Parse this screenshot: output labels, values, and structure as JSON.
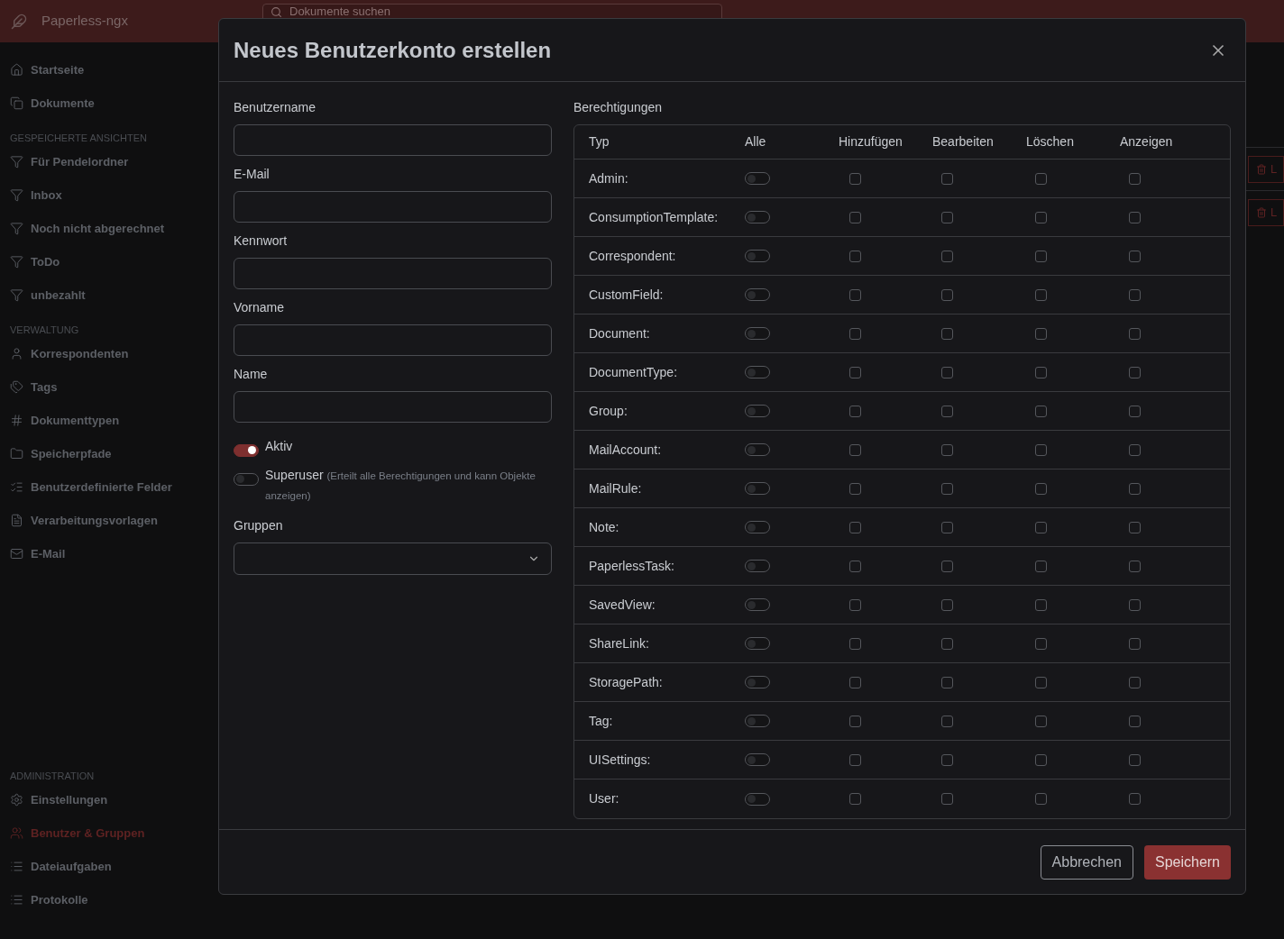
{
  "app": {
    "title": "Paperless-ngx",
    "search": {
      "placeholder": "Dokumente suchen"
    }
  },
  "sidebar": {
    "sections": [
      {
        "items": [
          {
            "label": "Startseite",
            "selected": false
          },
          {
            "label": "Dokumente",
            "selected": false
          }
        ]
      },
      {
        "heading": "GESPEICHERTE ANSICHTEN",
        "items": [
          {
            "label": "Für Pendelordner",
            "selected": false
          },
          {
            "label": "Inbox",
            "selected": false
          },
          {
            "label": "Noch nicht abgerechnet",
            "selected": false
          },
          {
            "label": "ToDo",
            "selected": false
          },
          {
            "label": "unbezahlt",
            "selected": false
          }
        ]
      },
      {
        "heading": "VERWALTUNG",
        "items": [
          {
            "label": "Korrespondenten",
            "selected": false
          },
          {
            "label": "Tags",
            "selected": false
          },
          {
            "label": "Dokumenttypen",
            "selected": false
          },
          {
            "label": "Speicherpfade",
            "selected": false
          },
          {
            "label": "Benutzerdefinierte Felder",
            "selected": false
          },
          {
            "label": "Verarbeitungsvorlagen",
            "selected": false
          },
          {
            "label": "E-Mail",
            "selected": false
          }
        ]
      },
      {
        "heading": "ADMINISTRATION",
        "items": [
          {
            "label": "Einstellungen",
            "selected": false
          },
          {
            "label": "Benutzer & Gruppen",
            "selected": true
          },
          {
            "label": "Dateiaufgaben",
            "selected": false
          },
          {
            "label": "Protokolle",
            "selected": false
          }
        ]
      }
    ]
  },
  "background_rows": [
    {
      "button": "L"
    },
    {
      "button": "L"
    }
  ],
  "dialog": {
    "title": "Neues Benutzerkonto erstellen",
    "fields": [
      {
        "label": "Benutzername"
      },
      {
        "label": "E-Mail"
      },
      {
        "label": "Kennwort"
      },
      {
        "label": "Vorname"
      },
      {
        "label": "Name"
      }
    ],
    "switches": [
      {
        "label": "Aktiv",
        "on": true
      },
      {
        "label": "Superuser",
        "hint": "(Erteilt alle Berechtigungen und kann Objekte anzeigen)",
        "on": false
      }
    ],
    "groups": {
      "label": "Gruppen"
    },
    "permissions": {
      "label": "Berechtigungen",
      "columns": [
        "Typ",
        "Alle",
        "Hinzufügen",
        "Bearbeiten",
        "Löschen",
        "Anzeigen"
      ],
      "rows": [
        {
          "type": "Admin:",
          "all": false,
          "checks": [
            false,
            false,
            false,
            false
          ]
        },
        {
          "type": "ConsumptionTemplate:",
          "all": false,
          "checks": [
            false,
            false,
            false,
            false
          ]
        },
        {
          "type": "Correspondent:",
          "all": false,
          "checks": [
            false,
            false,
            false,
            false
          ]
        },
        {
          "type": "CustomField:",
          "all": false,
          "checks": [
            false,
            false,
            false,
            false
          ]
        },
        {
          "type": "Document:",
          "all": false,
          "checks": [
            false,
            false,
            false,
            false
          ]
        },
        {
          "type": "DocumentType:",
          "all": false,
          "checks": [
            false,
            false,
            false,
            false
          ]
        },
        {
          "type": "Group:",
          "all": false,
          "checks": [
            false,
            false,
            false,
            false
          ]
        },
        {
          "type": "MailAccount:",
          "all": false,
          "checks": [
            false,
            false,
            false,
            false
          ]
        },
        {
          "type": "MailRule:",
          "all": false,
          "checks": [
            false,
            false,
            false,
            false
          ]
        },
        {
          "type": "Note:",
          "all": false,
          "checks": [
            false,
            false,
            false,
            false
          ]
        },
        {
          "type": "PaperlessTask:",
          "all": false,
          "checks": [
            false,
            false,
            false,
            false
          ]
        },
        {
          "type": "SavedView:",
          "all": false,
          "checks": [
            false,
            false,
            false,
            false
          ]
        },
        {
          "type": "ShareLink:",
          "all": false,
          "checks": [
            false,
            false,
            false,
            false
          ]
        },
        {
          "type": "StoragePath:",
          "all": false,
          "checks": [
            false,
            false,
            false,
            false
          ]
        },
        {
          "type": "Tag:",
          "all": false,
          "checks": [
            false,
            false,
            false,
            false
          ]
        },
        {
          "type": "UISettings:",
          "all": false,
          "checks": [
            false,
            false,
            false,
            false
          ]
        },
        {
          "type": "User:",
          "all": false,
          "checks": [
            false,
            false,
            false,
            false
          ]
        }
      ]
    },
    "buttons": {
      "cancel": "Abbrechen",
      "save": "Speichern"
    }
  }
}
